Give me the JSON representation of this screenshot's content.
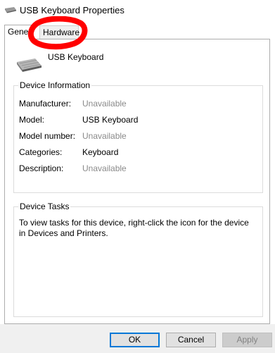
{
  "window": {
    "title": "USB Keyboard Properties",
    "icon": "keyboard-icon"
  },
  "tabs": [
    {
      "label": "General",
      "selected": true
    },
    {
      "label": "Hardware",
      "selected": false
    }
  ],
  "device": {
    "name": "USB Keyboard",
    "icon": "keyboard-icon"
  },
  "device_information": {
    "title": "Device Information",
    "rows": [
      {
        "label": "Manufacturer:",
        "value": "Unavailable"
      },
      {
        "label": "Model:",
        "value": "USB Keyboard"
      },
      {
        "label": "Model number:",
        "value": "Unavailable"
      },
      {
        "label": "Categories:",
        "value": "Keyboard"
      },
      {
        "label": "Description:",
        "value": "Unavailable"
      }
    ]
  },
  "device_tasks": {
    "title": "Device Tasks",
    "text": "To view tasks for this device, right-click the icon for the device in Devices and Printers."
  },
  "buttons": {
    "ok": "OK",
    "cancel": "Cancel",
    "apply": "Apply"
  },
  "colors": {
    "annotation": "#ff0000",
    "focus_border": "#0078d7",
    "unavailable_text": "#8a8a8a"
  }
}
